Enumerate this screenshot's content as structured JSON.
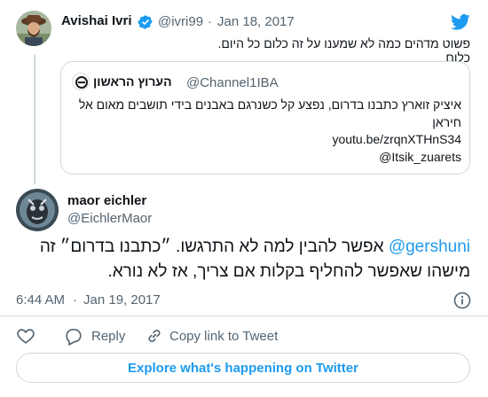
{
  "tweet1": {
    "author_name": "Avishai Ivri",
    "handle": "@ivri99",
    "separator": "·",
    "date": "Jan 18, 2017",
    "text": "פשוט מדהים כמה לא שמענו על זה כלום כל היום. כלום"
  },
  "quoted": {
    "author_name": "הערוץ הראשון",
    "handle": "@Channel1IBA",
    "text_line1": "איציק זוארץ כתבנו בדרום, נפצע קל כשנרגם באבנים בידי תושבים מאום אל",
    "text_line2": "חיראן",
    "link": "youtu.be/zrqnXTHnS34",
    "mention": "@Itsik_zuarets"
  },
  "tweet2": {
    "author_name": "maor eichler",
    "handle": "@EichlerMaor",
    "mention": "@gershuni",
    "text_line1_rest": "אפשר להבין למה לא התרגשו. ״כתבנו בדרום״ זה",
    "text_line2": "מישהו שאפשר להחליף בקלות אם צריך, אז לא נורא.",
    "time": "6:44 AM",
    "separator": "·",
    "date": "Jan 19, 2017"
  },
  "actions": {
    "reply_label": "Reply",
    "copy_link_label": "Copy link to Tweet"
  },
  "footer": {
    "explore_label": "Explore what's happening on Twitter"
  },
  "icons": {
    "brand": "twitter-bird-icon",
    "verified": "verified-badge-icon",
    "info": "info-icon",
    "like": "heart-icon",
    "reply": "reply-icon",
    "link": "link-icon"
  },
  "colors": {
    "accent": "#1d9bf0",
    "text": "#0f1419",
    "muted": "#536471",
    "border": "#cfd9de"
  }
}
